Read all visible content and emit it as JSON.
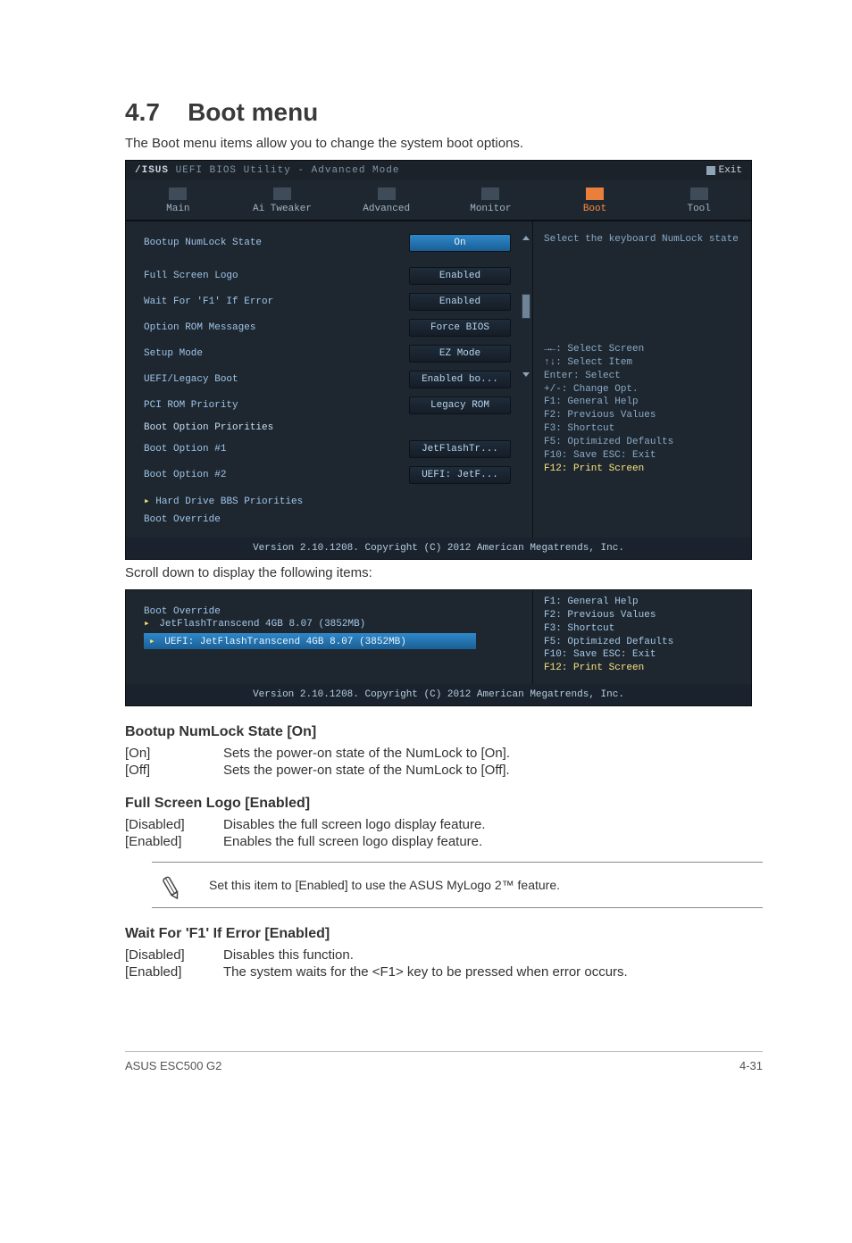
{
  "heading": {
    "number": "4.7",
    "title": "Boot menu"
  },
  "intro": "The Boot menu items allow you to change the system boot options.",
  "bios": {
    "title": "UEFI BIOS Utility - Advanced Mode",
    "exit": "Exit",
    "tabs": [
      {
        "name": "main-tab",
        "label": "Main"
      },
      {
        "name": "ai-tweaker-tab",
        "label": "Ai Tweaker"
      },
      {
        "name": "advanced-tab",
        "label": "Advanced"
      },
      {
        "name": "monitor-tab",
        "label": "Monitor"
      },
      {
        "name": "boot-tab",
        "label": "Boot"
      },
      {
        "name": "tool-tab",
        "label": "Tool"
      }
    ],
    "activeTab": 4,
    "rows": [
      {
        "label": "Bootup NumLock State",
        "value": "On",
        "selected": true
      },
      {
        "label": "Full Screen Logo",
        "value": "Enabled"
      },
      {
        "label": "Wait For 'F1' If Error",
        "value": "Enabled"
      },
      {
        "label": "Option ROM Messages",
        "value": "Force BIOS"
      },
      {
        "label": "Setup Mode",
        "value": "EZ Mode"
      },
      {
        "label": "UEFI/Legacy Boot",
        "value": "Enabled bo..."
      },
      {
        "label": "PCI ROM Priority",
        "value": "Legacy ROM"
      }
    ],
    "bootPriorities": {
      "title": "Boot Option Priorities",
      "options": [
        {
          "label": "Boot Option #1",
          "value": "JetFlashTr..."
        },
        {
          "label": "Boot Option #2",
          "value": "UEFI: JetF..."
        }
      ]
    },
    "hardDrivePriorities": "Hard Drive BBS Priorities",
    "bootOverride": "Boot Override",
    "helpTitle": "Select the keyboard NumLock state",
    "keyHints": [
      "→←: Select Screen",
      "↑↓: Select Item",
      "Enter: Select",
      "+/-: Change Opt.",
      "F1: General Help",
      "F2: Previous Values",
      "F3: Shortcut",
      "F5: Optimized Defaults",
      "F10: Save  ESC: Exit",
      "F12: Print Screen"
    ],
    "version": "Version 2.10.1208. Copyright (C) 2012 American Megatrends, Inc."
  },
  "scrollCaption": "Scroll down to display the following items:",
  "fragment": {
    "overrideTitle": "Boot Override",
    "devices": [
      "JetFlashTranscend 4GB 8.07  (3852MB)",
      "UEFI: JetFlashTranscend 4GB 8.07 (3852MB)"
    ],
    "hints": [
      "F1: General Help",
      "F2: Previous Values",
      "F3: Shortcut",
      "F5: Optimized Defaults",
      "F10: Save  ESC: Exit",
      "F12: Print Screen"
    ],
    "version": "Version 2.10.1208. Copyright (C) 2012 American Megatrends, Inc."
  },
  "descriptions": {
    "numlock": {
      "heading": "Bootup NumLock State [On]",
      "options": [
        {
          "key": "[On]",
          "text": "Sets the power-on state of the NumLock to [On]."
        },
        {
          "key": "[Off]",
          "text": "Sets the power-on state of the NumLock to [Off]."
        }
      ]
    },
    "fullscreen": {
      "heading": "Full Screen Logo [Enabled]",
      "options": [
        {
          "key": "[Disabled]",
          "text": "Disables the full screen logo display feature."
        },
        {
          "key": "[Enabled]",
          "text": "Enables the full screen logo display feature."
        }
      ]
    },
    "note": "Set this item to [Enabled] to use the ASUS MyLogo 2™ feature.",
    "waitf1": {
      "heading": "Wait For 'F1' If Error [Enabled]",
      "options": [
        {
          "key": "[Disabled]",
          "text": "Disables this function."
        },
        {
          "key": "[Enabled]",
          "text": "The system waits for the <F1> key to be pressed when error occurs."
        }
      ]
    }
  },
  "footer": {
    "left": "ASUS ESC500 G2",
    "right": "4-31"
  }
}
